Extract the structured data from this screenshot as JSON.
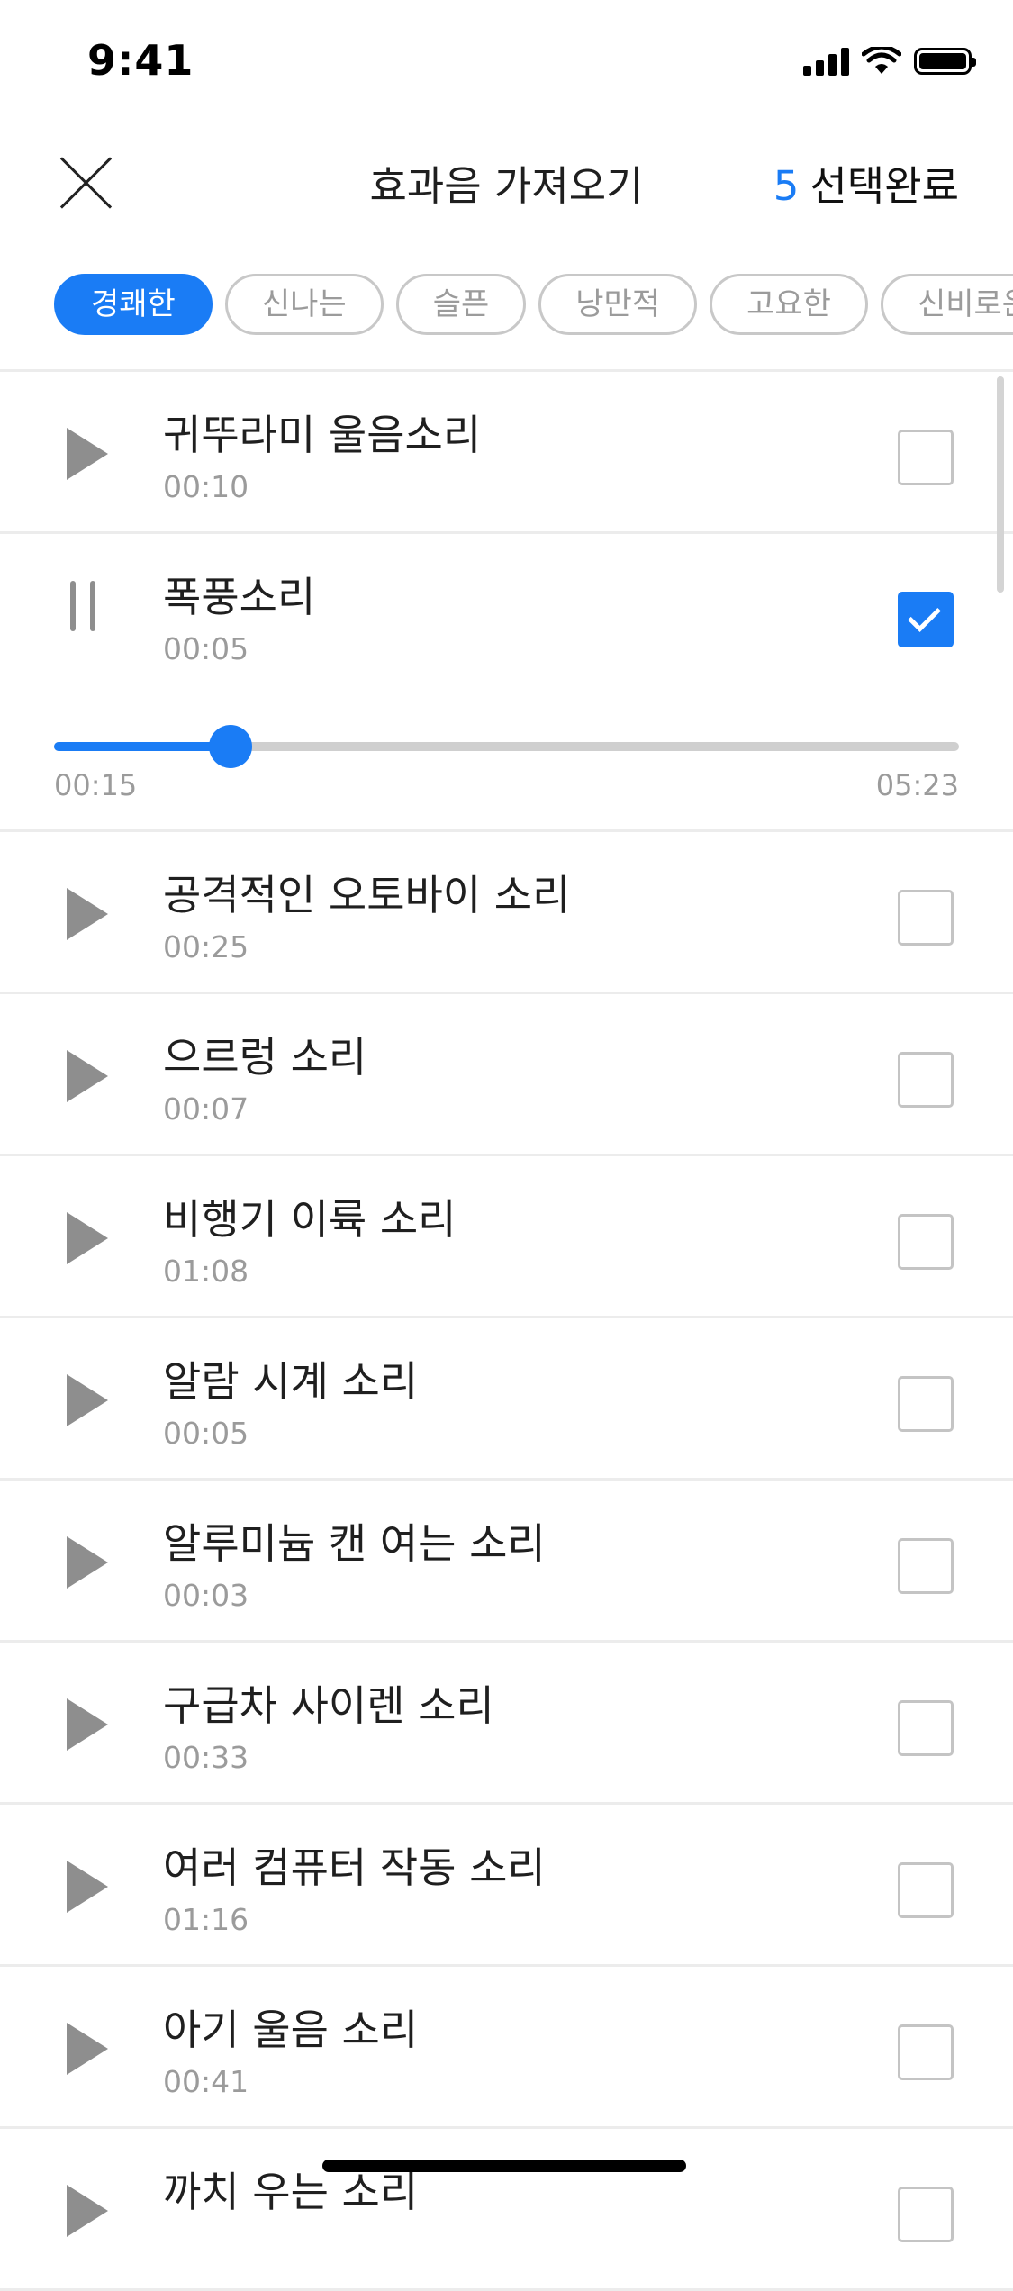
{
  "status_bar": {
    "time": "9:41"
  },
  "header": {
    "title": "효과음 가져오기",
    "selected_count": "5",
    "done_label": "선택완료"
  },
  "filters": [
    {
      "label": "경쾌한",
      "active": true
    },
    {
      "label": "신나는",
      "active": false
    },
    {
      "label": "슬픈",
      "active": false
    },
    {
      "label": "낭만적",
      "active": false
    },
    {
      "label": "고요한",
      "active": false
    },
    {
      "label": "신비로운",
      "active": false
    }
  ],
  "player": {
    "elapsed": "00:15",
    "total": "05:23",
    "progress_fraction": 0.195
  },
  "sounds": [
    {
      "title": "귀뚜라미 울음소리",
      "duration": "00:10",
      "checked": false,
      "playing": false
    },
    {
      "title": "폭풍소리",
      "duration": "00:05",
      "checked": true,
      "playing": true
    },
    {
      "title": "공격적인 오토바이 소리",
      "duration": "00:25",
      "checked": false,
      "playing": false
    },
    {
      "title": "으르렁 소리",
      "duration": "00:07",
      "checked": false,
      "playing": false
    },
    {
      "title": "비행기 이륙 소리",
      "duration": "01:08",
      "checked": false,
      "playing": false
    },
    {
      "title": "알람 시계 소리",
      "duration": "00:05",
      "checked": false,
      "playing": false
    },
    {
      "title": "알루미늄 캔 여는 소리",
      "duration": "00:03",
      "checked": false,
      "playing": false
    },
    {
      "title": "구급차 사이렌 소리",
      "duration": "00:33",
      "checked": false,
      "playing": false
    },
    {
      "title": "여러 컴퓨터 작동 소리",
      "duration": "01:16",
      "checked": false,
      "playing": false
    },
    {
      "title": "아기 울음 소리",
      "duration": "00:41",
      "checked": false,
      "playing": false
    },
    {
      "title": "까치 우는 소리",
      "duration": "",
      "checked": false,
      "playing": false
    }
  ]
}
